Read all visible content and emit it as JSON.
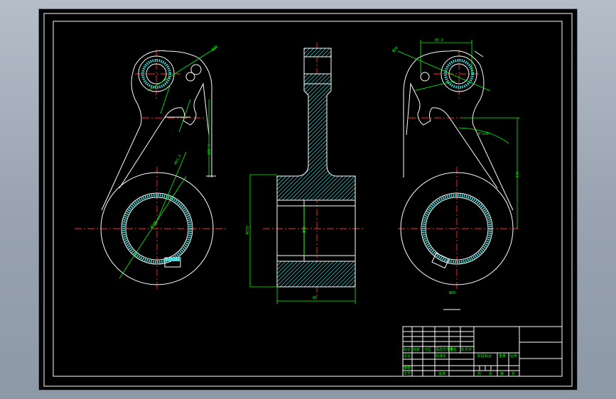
{
  "colors": {
    "background": "#000000",
    "outline": "#ffffff",
    "dimension": "#00ff00",
    "centerline": "#ff2b2b",
    "section_hatch": "#3ee0e0"
  },
  "view": {
    "type": "mechanical-cad-drawing",
    "views": [
      "front-view",
      "section-view",
      "rear-view"
    ]
  },
  "title_block": {
    "labels": [
      "标记",
      "处数",
      "分区",
      "更改文件号",
      "签名",
      "年月日",
      "设计",
      "标准化",
      "阶段标记",
      "重量",
      "比例",
      "审核",
      "工艺",
      "批准",
      "共",
      "张",
      "第",
      "张"
    ]
  }
}
